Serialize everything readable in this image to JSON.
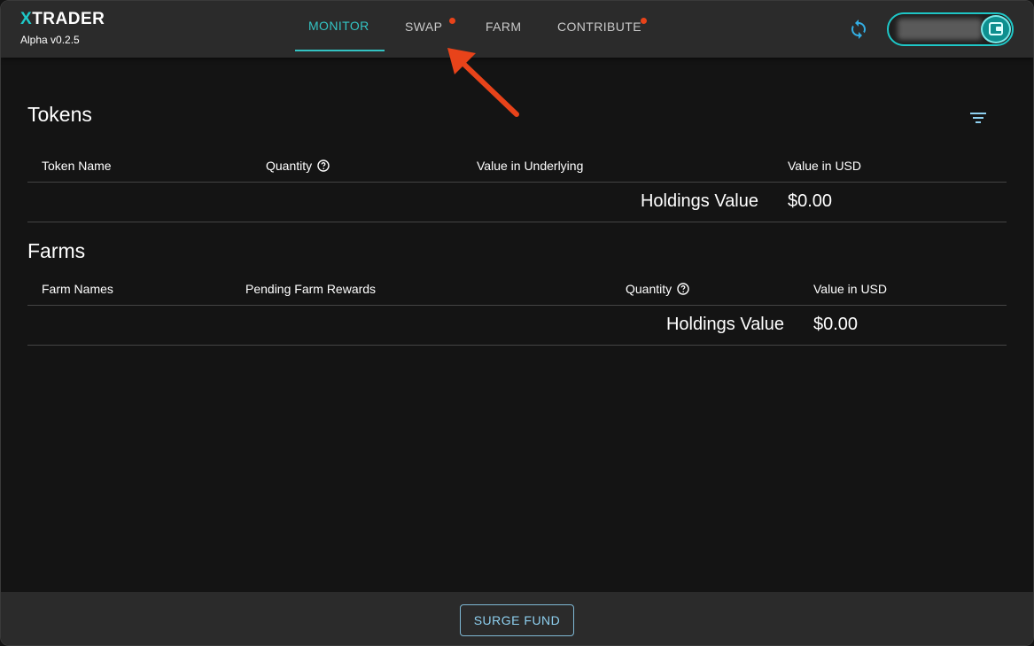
{
  "app": {
    "logo_x": "X",
    "logo_rest": "TRADER",
    "version": "Alpha v0.2.5"
  },
  "nav": {
    "items": [
      {
        "label": "MONITOR",
        "active": true,
        "badge": false
      },
      {
        "label": "SWAP",
        "active": false,
        "badge": true
      },
      {
        "label": "FARM",
        "active": false,
        "badge": false
      },
      {
        "label": "CONTRIBUTE",
        "active": false,
        "badge": true
      }
    ]
  },
  "header_icons": {
    "refresh": "refresh-icon",
    "wallet": "wallet-icon"
  },
  "tokens": {
    "title": "Tokens",
    "columns": [
      "Token Name",
      "Quantity",
      "Value in Underlying",
      "Value in USD"
    ],
    "rows": [],
    "holdings_label": "Holdings Value",
    "holdings_value": "$0.00"
  },
  "farms": {
    "title": "Farms",
    "columns": [
      "Farm Names",
      "Pending Farm Rewards",
      "Quantity",
      "Value in USD"
    ],
    "rows": [],
    "holdings_label": "Holdings Value",
    "holdings_value": "$0.00"
  },
  "footer": {
    "button_label": "SURGE FUND"
  },
  "colors": {
    "accent": "#33c3c3",
    "badge": "#e8431a",
    "annotation_arrow": "#e8431a",
    "background": "#141414",
    "header": "#2b2b2b"
  }
}
